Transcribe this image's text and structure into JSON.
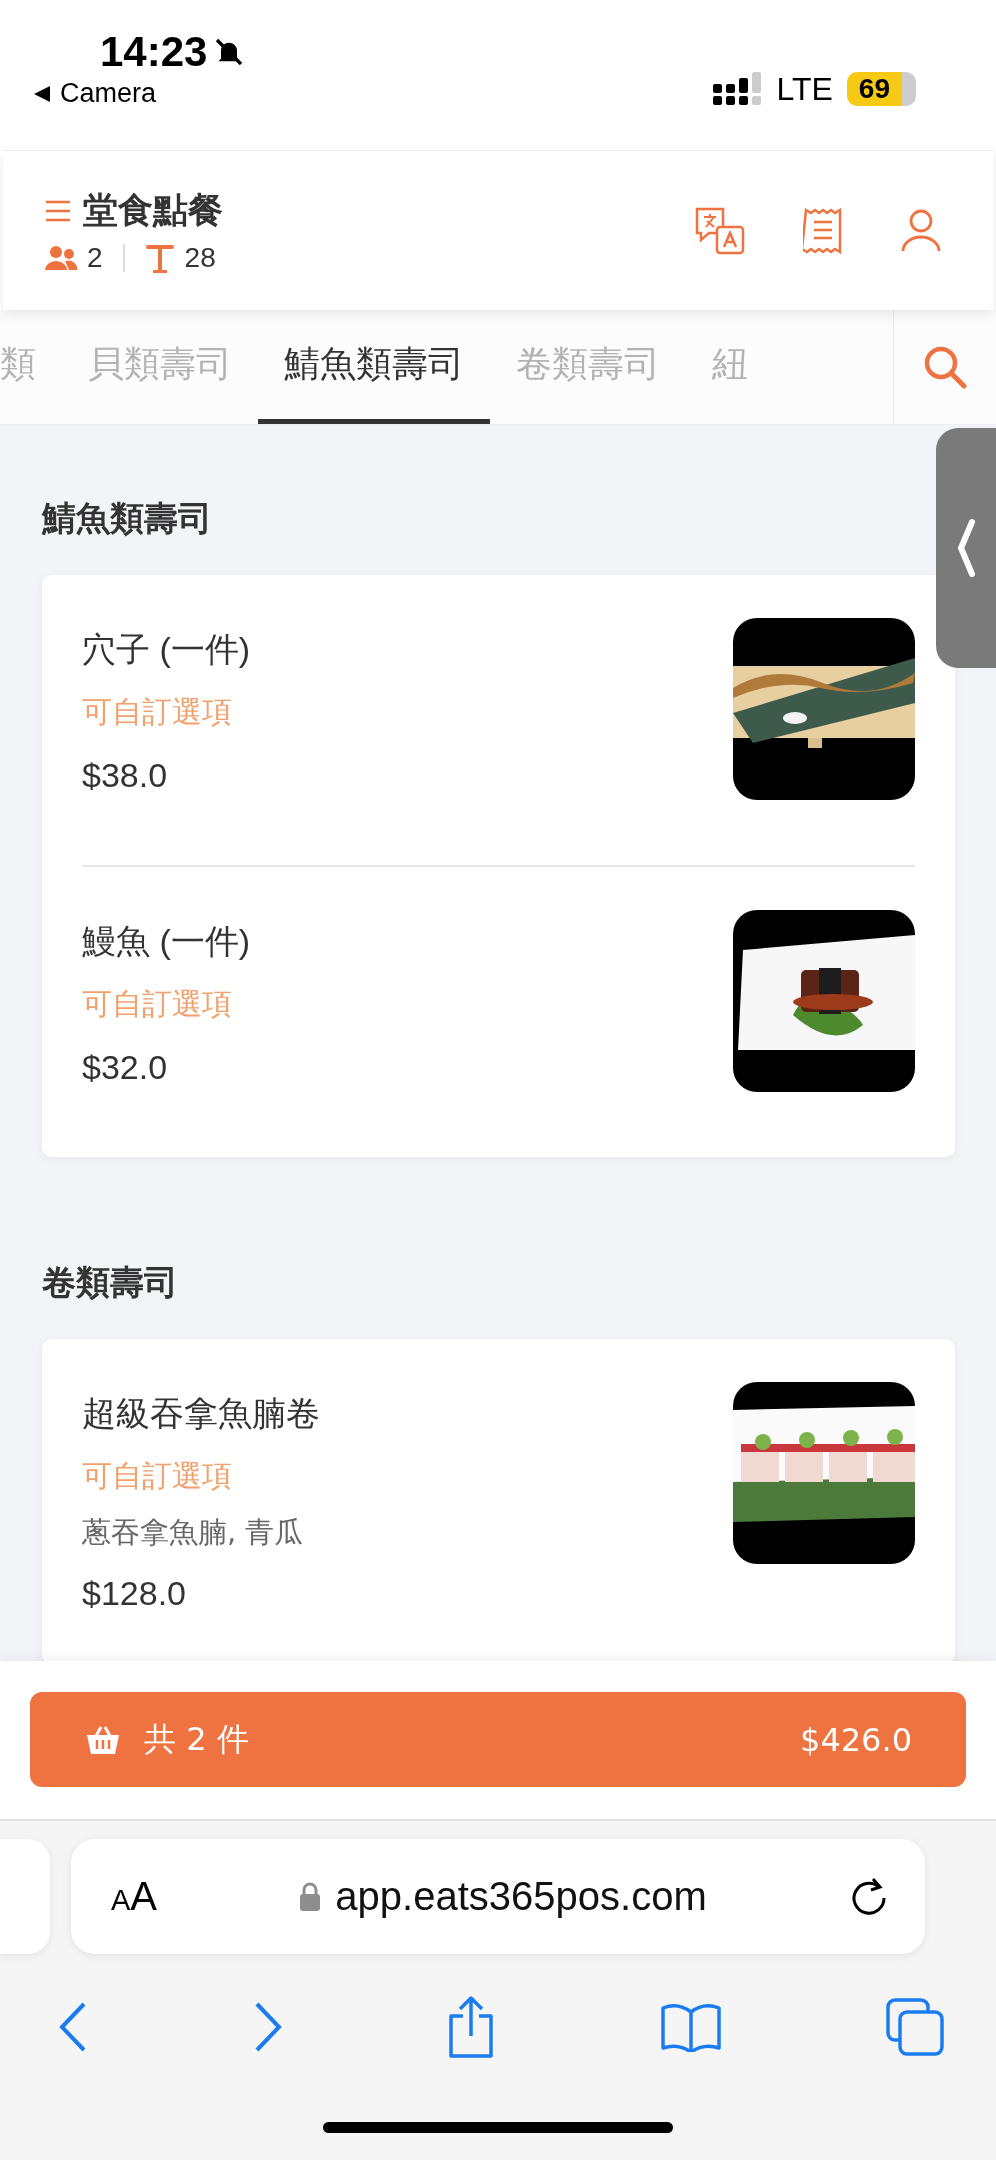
{
  "status_bar": {
    "time": "14:23",
    "back_label": "Camera",
    "network": "LTE",
    "battery": "69"
  },
  "header": {
    "title": "堂食點餐",
    "guests": "2",
    "table": "28"
  },
  "category_tabs": [
    {
      "label": "類",
      "selected": false
    },
    {
      "label": "貝類壽司",
      "selected": false
    },
    {
      "label": "鯖魚類壽司",
      "selected": true
    },
    {
      "label": "卷類壽司",
      "selected": false
    },
    {
      "label": "紐",
      "selected": false
    }
  ],
  "sections": [
    {
      "title": "鯖魚類壽司",
      "items": [
        {
          "name": "穴子 (一件)",
          "option_label": "可自訂選項",
          "price": "$38.0"
        },
        {
          "name": "鰻魚 (一件)",
          "option_label": "可自訂選項",
          "price": "$32.0"
        }
      ]
    },
    {
      "title": "卷類壽司",
      "items": [
        {
          "name": "超級吞拿魚腩卷",
          "option_label": "可自訂選項",
          "description": "蔥吞拿魚腩, 青瓜",
          "price": "$128.0"
        }
      ]
    }
  ],
  "cart_button": {
    "count_label": "共 2 件",
    "total": "$426.0"
  },
  "browser": {
    "text_size_label": "AA",
    "url": "app.eats365pos.com"
  }
}
